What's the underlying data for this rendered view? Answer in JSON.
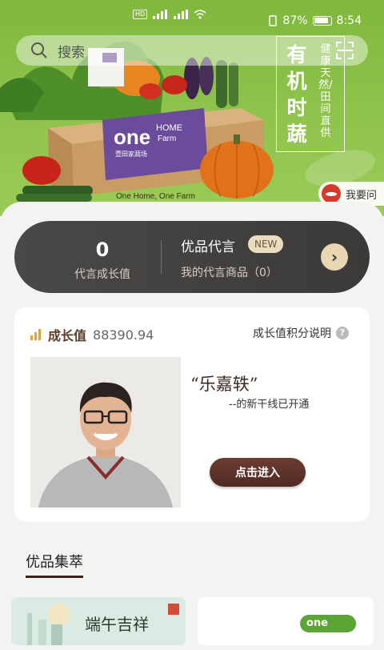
{
  "status_bar": {
    "battery": "87%",
    "time": "8:54"
  },
  "search": {
    "placeholder": "搜索"
  },
  "banner": {
    "title": "有机时蔬",
    "subtitle": "健康天然/田间直供",
    "box_brand": "one",
    "box_brand_home": "HOME",
    "box_brand_farm": "Farm",
    "box_brand_cn": "壹田家蔬场",
    "box_slogan": "One Home, One Farm"
  },
  "ask_button": {
    "label": "我要问"
  },
  "promo": {
    "growth_number": "0",
    "growth_number_label": "代言成长值",
    "title": "优品代言",
    "badge": "NEW",
    "subtitle": "我的代言商品（0）",
    "arrow": "›"
  },
  "growth_card": {
    "label": "成长值",
    "value": "88390.94",
    "explain_label": "成长值积分说明",
    "help": "?",
    "quote": "“乐嘉轶”",
    "quote_sub": "--的新干线已开通",
    "enter_label": "点击进入"
  },
  "section": {
    "title": "优品集萃"
  },
  "tiles": {
    "tile1_text": "端午吉祥",
    "tile2_logo": "one HOME"
  },
  "colors": {
    "banner_green": "#8dc24a",
    "dark_pill": "#3b3a38",
    "accent_brown": "#5a3a28",
    "badge_beige": "#e9dcc0"
  }
}
